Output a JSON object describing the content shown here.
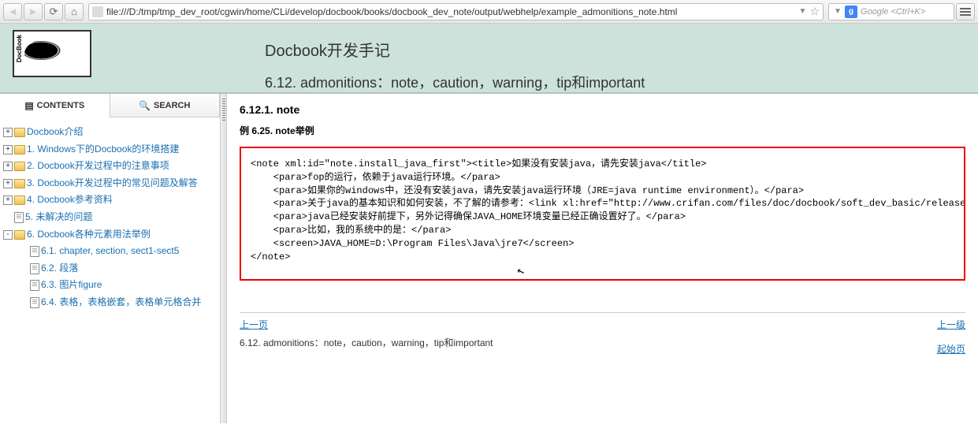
{
  "browser": {
    "url": "file:///D:/tmp/tmp_dev_root/cgwin/home/CLi/develop/docbook/books/docbook_dev_note/output/webhelp/example_admonitions_note.html",
    "search_placeholder": "Google <Ctrl+K>",
    "search_engine_letter": "g"
  },
  "header": {
    "logo_label": "DocBook",
    "main_title": "Docbook开发手记",
    "sub_title": "6.12. admonitions：note，caution，warning，tip和important"
  },
  "tabs": {
    "contents": "CONTENTS",
    "search": "SEARCH"
  },
  "tree": [
    {
      "expand": "+",
      "type": "folder",
      "label": "Docbook介绍",
      "level": 0
    },
    {
      "expand": "+",
      "type": "folder",
      "label": "1. Windows下的Docbook的环境搭建",
      "level": 0
    },
    {
      "expand": "+",
      "type": "folder",
      "label": "2. Docbook开发过程中的注意事项",
      "level": 0
    },
    {
      "expand": "+",
      "type": "folder",
      "label": "3. Docbook开发过程中的常见问题及解答",
      "level": 0
    },
    {
      "expand": "+",
      "type": "folder",
      "label": "4. Docbook参考资料",
      "level": 0
    },
    {
      "expand": "",
      "type": "page",
      "label": "5. 未解决的问题",
      "level": 0
    },
    {
      "expand": "-",
      "type": "folder",
      "label": "6. Docbook各种元素用法举例",
      "level": 0
    },
    {
      "expand": "",
      "type": "page",
      "label": "6.1. chapter, section, sect1-sect5",
      "level": 1
    },
    {
      "expand": "",
      "type": "page",
      "label": "6.2. 段落",
      "level": 1
    },
    {
      "expand": "",
      "type": "page",
      "label": "6.3. 图片figure",
      "level": 1
    },
    {
      "expand": "",
      "type": "page",
      "label": "6.4. 表格，表格嵌套，表格单元格合并",
      "level": 1
    }
  ],
  "main": {
    "section_title": "6.12.1. note",
    "example_title": "例 6.25. note举例",
    "code": "<note xml:id=\"note.install_java_first\"><title>如果没有安装java，请先安装java</title>\n    <para>fop的运行，依赖于java运行环境。</para>\n    <para>如果你的windows中，还没有安装java，请先安装java运行环境（JRE=java runtime environment）。</para>\n    <para>关于java的基本知识和如何安装，不了解的请参考：<link xl:href=\"http://www.crifan.com/files/doc/docbook/soft_dev_basic/release/html/sof\n    <para>java已经安装好前提下，另外记得确保JAVA_HOME环境变量已经正确设置好了。</para>\n    <para>比如，我的系统中的是：</para>\n    <screen>JAVA_HOME=D:\\Program Files\\Java\\jre7</screen>\n</note>"
  },
  "footer": {
    "prev": "上一页",
    "up": "上一级",
    "home": "起始页",
    "prev_title": "6.12. admonitions：note，caution，warning，tip和important"
  }
}
